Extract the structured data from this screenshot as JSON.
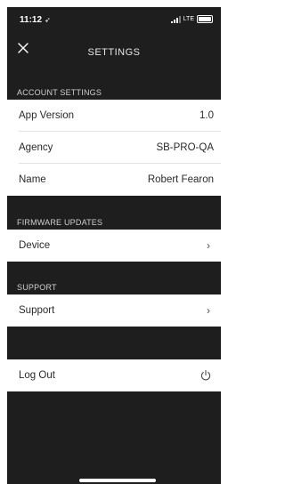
{
  "status_bar": {
    "time": "11:12",
    "location_glyph": "➶",
    "network": "LTE"
  },
  "nav": {
    "title": "SETTINGS",
    "close_icon": "close-x"
  },
  "account_settings": {
    "header": "ACCOUNT SETTINGS",
    "rows": [
      {
        "label": "App Version",
        "value": "1.0"
      },
      {
        "label": "Agency",
        "value": "SB-PRO-QA"
      },
      {
        "label": "Name",
        "value": "Robert Fearon"
      }
    ]
  },
  "firmware_updates": {
    "header": "FIRMWARE UPDATES",
    "rows": [
      {
        "label": "Device",
        "chevron": "›"
      }
    ]
  },
  "support": {
    "header": "SUPPORT",
    "rows": [
      {
        "label": "Support",
        "chevron": "›"
      }
    ]
  },
  "logout": {
    "label": "Log Out",
    "icon": "power-icon"
  }
}
